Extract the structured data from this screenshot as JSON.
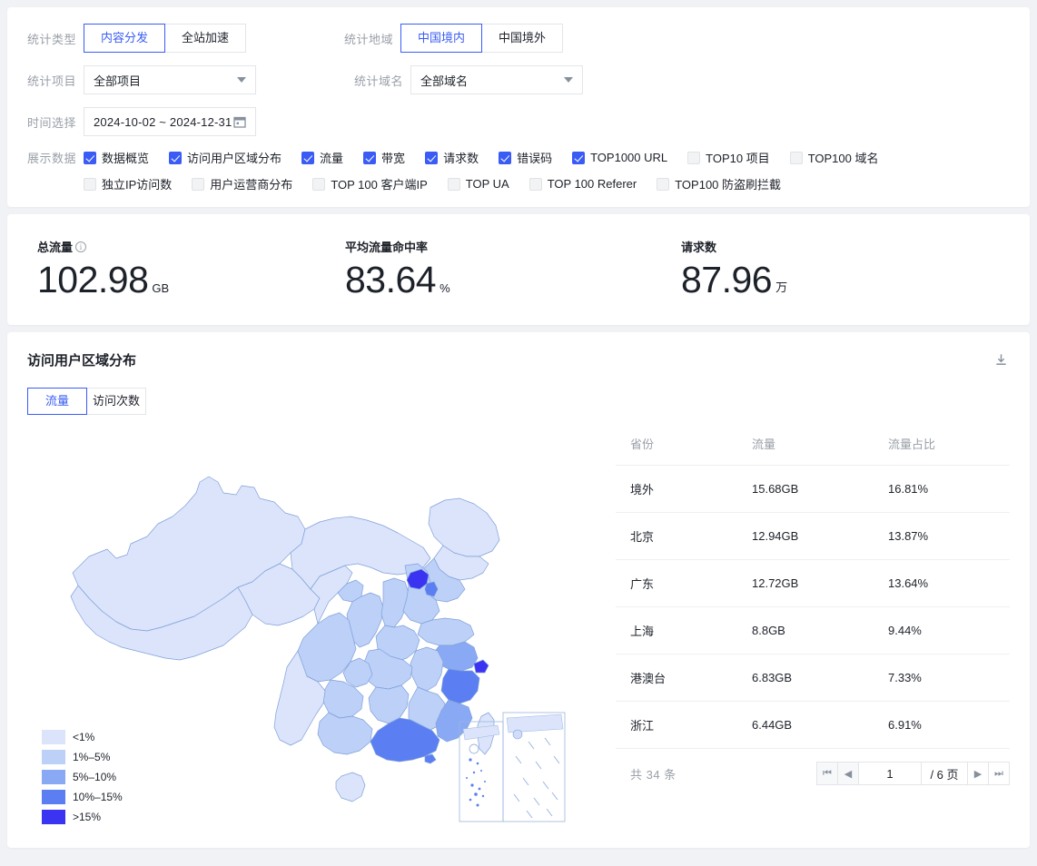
{
  "filters": {
    "stat_type": {
      "label": "统计类型",
      "options": [
        "内容分发",
        "全站加速"
      ],
      "selected": "内容分发"
    },
    "stat_region": {
      "label": "统计地域",
      "options": [
        "中国境内",
        "中国境外"
      ],
      "selected": "中国境内"
    },
    "stat_project": {
      "label": "统计项目",
      "value": "全部项目"
    },
    "stat_domain": {
      "label": "统计域名",
      "value": "全部域名"
    },
    "time_range": {
      "label": "时间选择",
      "value": "2024-10-02  ~ 2024-12-31"
    },
    "display_data": {
      "label": "展示数据",
      "row1": [
        {
          "label": "数据概览",
          "checked": true
        },
        {
          "label": "访问用户区域分布",
          "checked": true
        },
        {
          "label": "流量",
          "checked": true
        },
        {
          "label": "带宽",
          "checked": true
        },
        {
          "label": "请求数",
          "checked": true
        },
        {
          "label": "错误码",
          "checked": true
        },
        {
          "label": "TOP1000 URL",
          "checked": true
        },
        {
          "label": "TOP10 项目",
          "checked": false
        },
        {
          "label": "TOP100 域名",
          "checked": false
        }
      ],
      "row2": [
        {
          "label": "独立IP访问数",
          "checked": false
        },
        {
          "label": "用户运营商分布",
          "checked": false
        },
        {
          "label": "TOP 100 客户端IP",
          "checked": false
        },
        {
          "label": "TOP UA",
          "checked": false
        },
        {
          "label": "TOP 100 Referer",
          "checked": false
        },
        {
          "label": "TOP100 防盗刷拦截",
          "checked": false
        }
      ]
    }
  },
  "stats": [
    {
      "title": "总流量",
      "has_info": true,
      "value": "102.98",
      "unit": "GB"
    },
    {
      "title": "平均流量命中率",
      "has_info": false,
      "value": "83.64",
      "unit": "%"
    },
    {
      "title": "请求数",
      "has_info": false,
      "value": "87.96",
      "unit": "万"
    }
  ],
  "region": {
    "title": "访问用户区域分布",
    "download_icon": "download-icon",
    "tabs": [
      {
        "label": "流量",
        "active": true
      },
      {
        "label": "访问次数",
        "active": false
      }
    ],
    "legend": [
      {
        "label": "<1%",
        "color": "#dbe4fb"
      },
      {
        "label": "1%–5%",
        "color": "#bcd0f8"
      },
      {
        "label": "5%–10%",
        "color": "#8aa9f5"
      },
      {
        "label": "10%–15%",
        "color": "#5b7ef2"
      },
      {
        "label": ">15%",
        "color": "#3a34f2"
      }
    ],
    "table": {
      "columns": [
        "省份",
        "流量",
        "流量占比"
      ],
      "rows": [
        {
          "province": "境外",
          "flux": "15.68GB",
          "pct": "16.81%"
        },
        {
          "province": "北京",
          "flux": "12.94GB",
          "pct": "13.87%"
        },
        {
          "province": "广东",
          "flux": "12.72GB",
          "pct": "13.64%"
        },
        {
          "province": "上海",
          "flux": "8.8GB",
          "pct": "9.44%"
        },
        {
          "province": "港澳台",
          "flux": "6.83GB",
          "pct": "7.33%"
        },
        {
          "province": "浙江",
          "flux": "6.44GB",
          "pct": "6.91%"
        }
      ],
      "total_text": "共 34 条",
      "pager": {
        "first": "⏮",
        "prev": "◀",
        "current": "1",
        "of": "/ 6 页",
        "next": "▶",
        "last": "⏭"
      }
    }
  },
  "chart_data": {
    "type": "heatmap",
    "title": "访问用户区域分布",
    "metric": "流量",
    "unit": "GB",
    "legend_bins": [
      "<1%",
      "1%–5%",
      "5%–10%",
      "10%–15%",
      ">15%"
    ],
    "bin_colors": [
      "#dbe4fb",
      "#bcd0f8",
      "#8aa9f5",
      "#5b7ef2",
      "#3a34f2"
    ],
    "total_records": 34,
    "categories": [
      "境外",
      "北京",
      "广东",
      "上海",
      "港澳台",
      "浙江"
    ],
    "values": [
      15.68,
      12.94,
      12.72,
      8.8,
      6.83,
      6.44
    ],
    "percent": [
      16.81,
      13.87,
      13.64,
      9.44,
      7.33,
      6.91
    ]
  }
}
